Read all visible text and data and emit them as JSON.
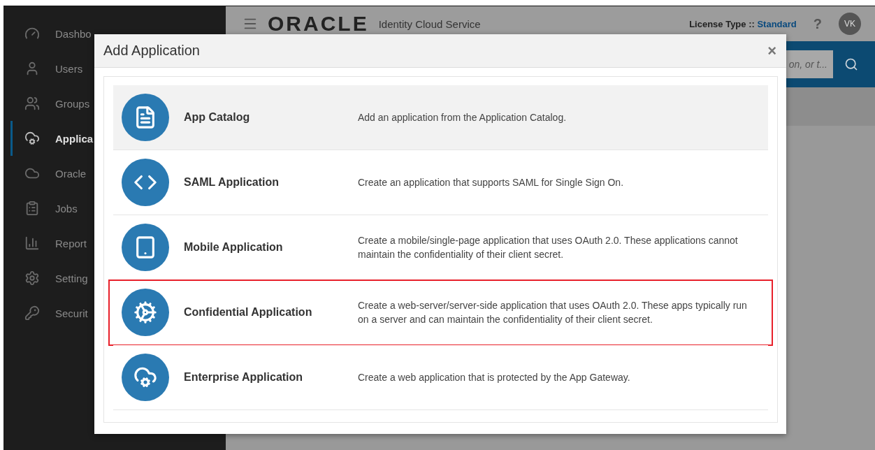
{
  "sidebar": {
    "items": [
      {
        "label": "Dashbo",
        "selected": false
      },
      {
        "label": "Users",
        "selected": false
      },
      {
        "label": "Groups",
        "selected": false
      },
      {
        "label": "Applica",
        "selected": true
      },
      {
        "label": "Oracle",
        "selected": false
      },
      {
        "label": "Jobs",
        "selected": false
      },
      {
        "label": "Report",
        "selected": false
      },
      {
        "label": "Setting",
        "selected": false
      },
      {
        "label": "Securit",
        "selected": false
      }
    ]
  },
  "header": {
    "logo": "ORACLE",
    "product": "Identity Cloud Service",
    "license_label": "License Type ::",
    "license_value": "Standard",
    "help": "?",
    "avatar": "VK"
  },
  "search": {
    "placeholder": "on, or t..."
  },
  "dialog": {
    "title": "Add Application",
    "close": "×",
    "options": [
      {
        "kind": "catalog",
        "title": "App Catalog",
        "description": "Add an application from the Application Catalog.",
        "selected": true,
        "highlighted": false
      },
      {
        "kind": "saml",
        "title": "SAML Application",
        "description": "Create an application that supports SAML for Single Sign On.",
        "selected": false,
        "highlighted": false
      },
      {
        "kind": "mobile",
        "title": "Mobile Application",
        "description": "Create a mobile/single-page application that uses OAuth 2.0. These applications cannot maintain the confidentiality of their client secret.",
        "selected": false,
        "highlighted": false
      },
      {
        "kind": "confidential",
        "title": "Confidential Application",
        "description": "Create a web-server/server-side application that uses OAuth 2.0. These apps typically run on a server and can maintain the confidentiality of their client secret.",
        "selected": false,
        "highlighted": true
      },
      {
        "kind": "enterprise",
        "title": "Enterprise Application",
        "description": "Create a web application that is protected by the App Gateway.",
        "selected": false,
        "highlighted": false
      }
    ]
  }
}
